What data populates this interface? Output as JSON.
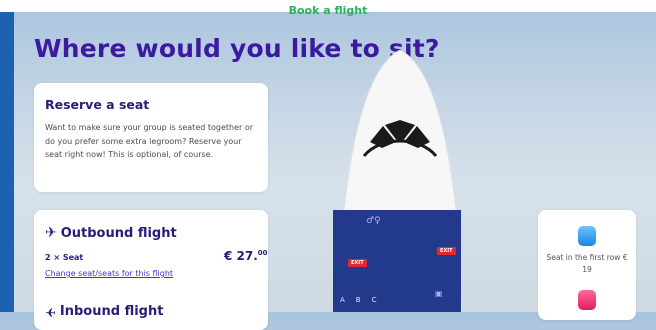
{
  "topbar": {
    "title": "Book a flight"
  },
  "page": {
    "heading": "Where would you like to sit?"
  },
  "reserve_card": {
    "title": "Reserve a seat",
    "description": "Want to make sure your group is seated together or do you prefer some extra legroom? Reserve your seat right now! This is optional, of course."
  },
  "outbound": {
    "title": "Outbound flight",
    "seat_count": "2 × Seat",
    "price": "€ 27.",
    "price_cents": "00",
    "change_link": "Change seat/seats for this flight"
  },
  "inbound": {
    "title": "Inbound flight"
  },
  "aircraft": {
    "exit_left": "EXIT",
    "exit_right": "EXIT",
    "seat_letters": [
      "A",
      "B",
      "C"
    ],
    "colors": {
      "cabin": "#233a8c",
      "exit": "#e0292f"
    }
  },
  "legend": {
    "first_row_label": "Seat in the first row € 19",
    "icons": {
      "first_row": "seat-blue-icon",
      "other": "seat-pink-icon"
    }
  },
  "colors": {
    "brand_green": "#25b35c",
    "heading_purple": "#3b1aa0",
    "left_strip": "#1d62b0"
  }
}
